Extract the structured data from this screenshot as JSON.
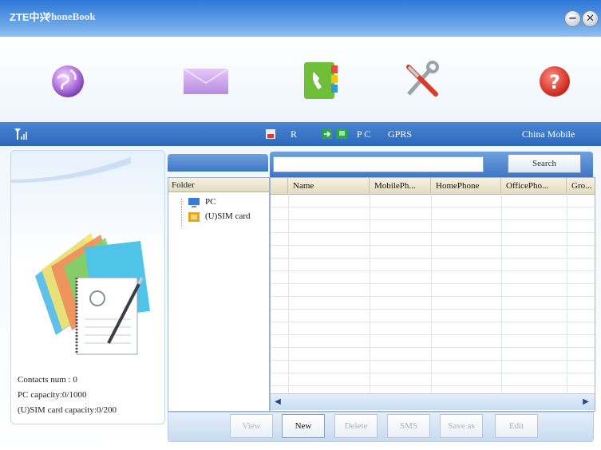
{
  "app": {
    "brand": "ZTE中兴",
    "title": "PhoneBook"
  },
  "window_controls": {
    "minimize": "−",
    "close": "✕"
  },
  "toolbar": {
    "items": [
      {
        "icon": "internet-globe-icon"
      },
      {
        "icon": "sms-envelope-icon"
      },
      {
        "icon": "phonebook-icon"
      },
      {
        "icon": "settings-tools-icon"
      },
      {
        "icon": "help-icon"
      }
    ]
  },
  "status": {
    "signal_icon": "signal-strength-icon",
    "roaming": "R",
    "mode": "P C",
    "network_type": "GPRS",
    "operator": "China Mobile"
  },
  "left_panel": {
    "contacts_num": "Contacts num : 0",
    "pc_capacity": "PC capacity:0/1000",
    "sim_capacity": "(U)SIM card capacity:0/200"
  },
  "folder": {
    "header": "Folder",
    "items": [
      {
        "label": "PC"
      },
      {
        "label": "(U)SIM card"
      }
    ]
  },
  "search": {
    "value": "",
    "button": "Search"
  },
  "table": {
    "columns": [
      "",
      "Name",
      "MobilePh...",
      "HomePhone",
      "OfficePho...",
      "Gro..."
    ],
    "rows": []
  },
  "actions": {
    "view": "View",
    "new": "New",
    "delete": "Delete",
    "sms": "SMS",
    "save_as": "Save as",
    "edit": "Edit"
  },
  "colors": {
    "title_bar": "#2f78d8",
    "status_bar": "#3a72c2",
    "accent": "#4a86d4"
  }
}
